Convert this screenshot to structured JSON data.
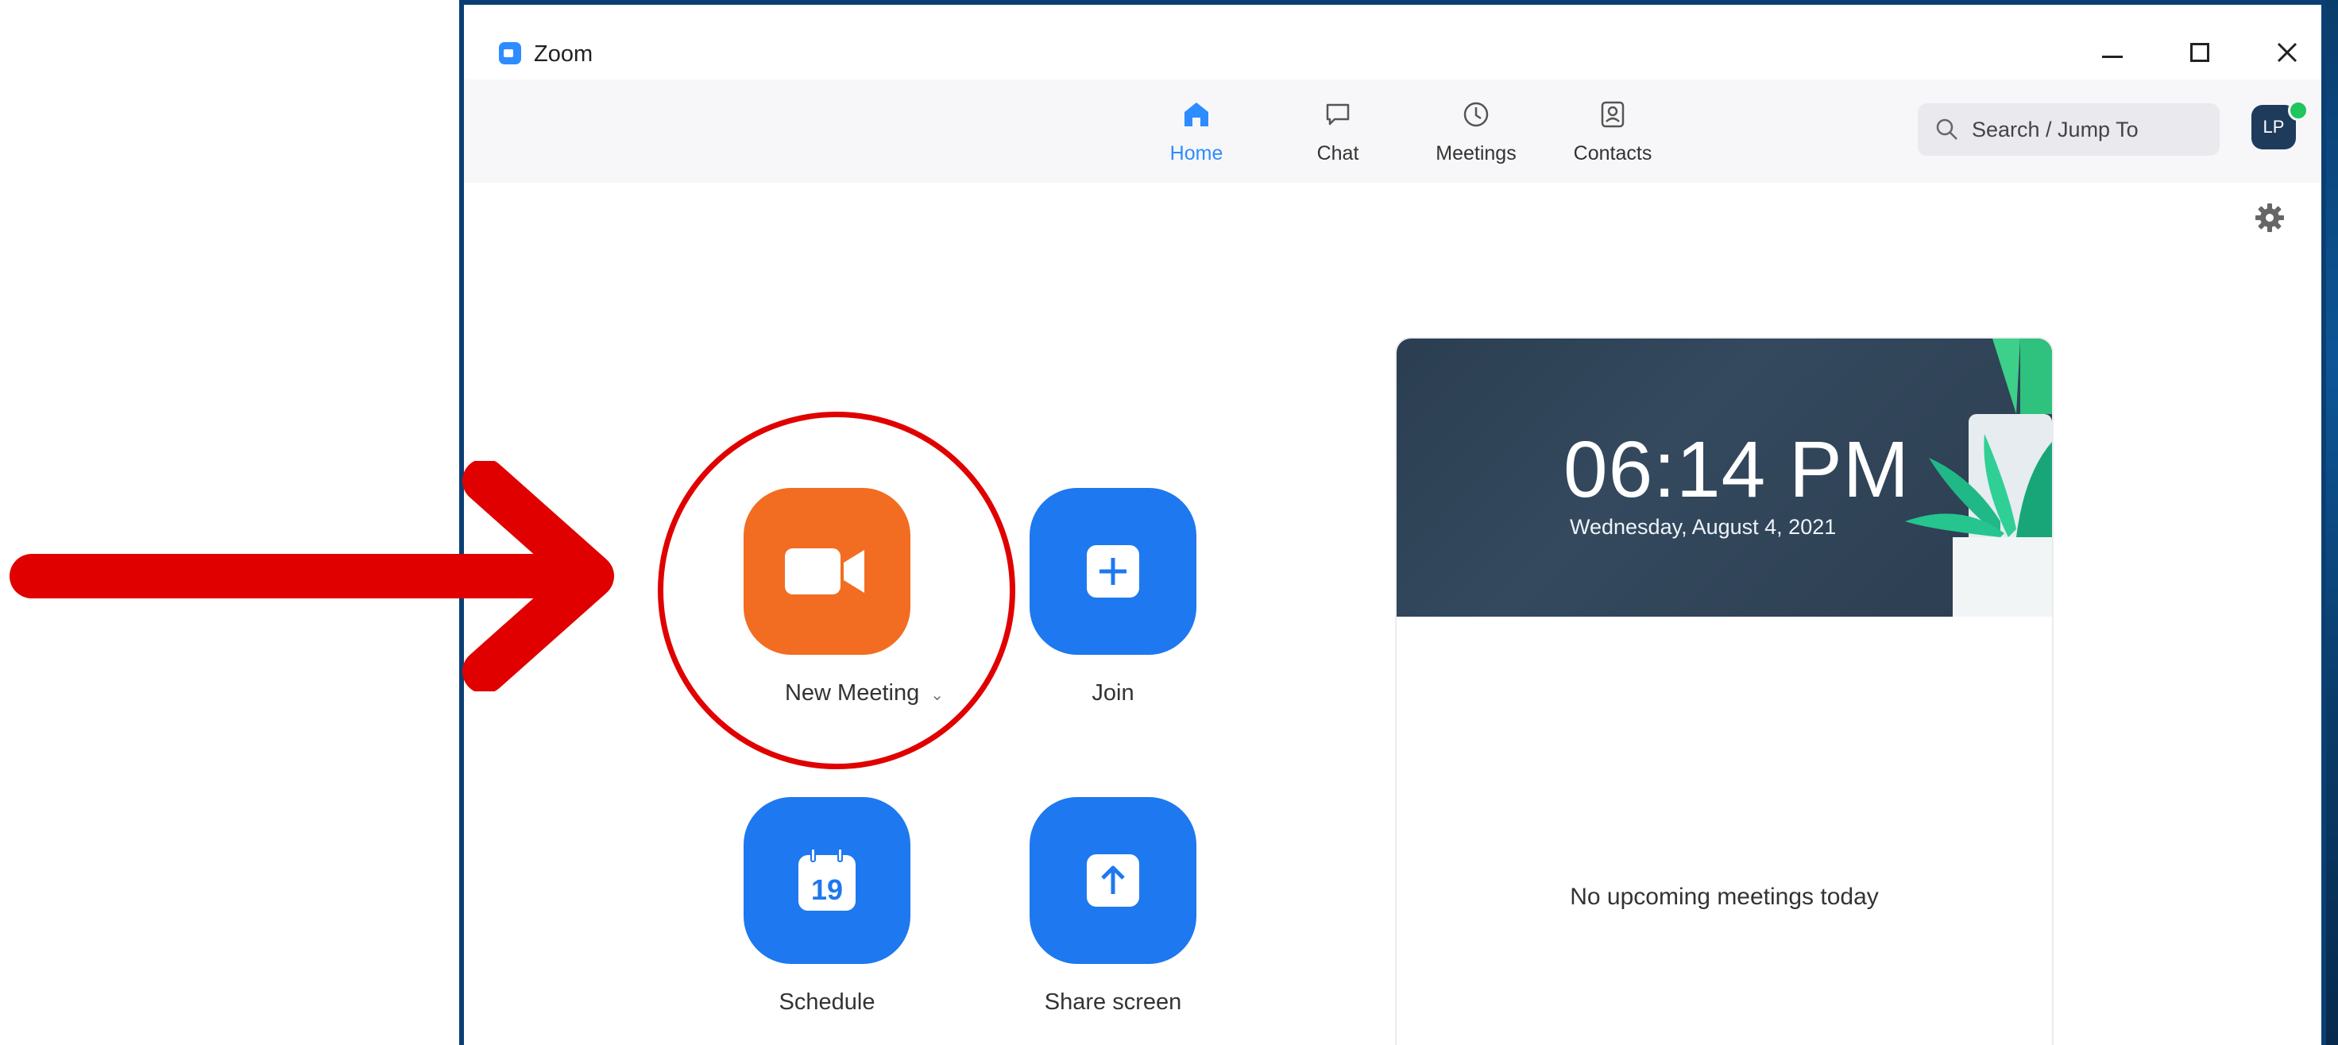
{
  "window": {
    "title": "Zoom",
    "controls": {
      "minimize": "–",
      "maximize": "□",
      "close": "✕"
    }
  },
  "tabs": [
    {
      "label": "Home",
      "icon": "home-icon",
      "active": true
    },
    {
      "label": "Chat",
      "icon": "chat-icon",
      "active": false
    },
    {
      "label": "Meetings",
      "icon": "clock-icon",
      "active": false
    },
    {
      "label": "Contacts",
      "icon": "contacts-icon",
      "active": false
    }
  ],
  "search": {
    "placeholder": "Search / Jump To"
  },
  "user": {
    "initials": "LP",
    "status_color": "#21c55d"
  },
  "actions": {
    "new_meeting": {
      "label": "New Meeting",
      "icon": "video-camera-icon",
      "color": "#f26d21"
    },
    "join": {
      "label": "Join",
      "icon": "plus-icon",
      "color": "#1e78ef"
    },
    "schedule": {
      "label": "Schedule",
      "icon": "calendar-icon",
      "calendar_day": "19",
      "color": "#1e78ef"
    },
    "share_screen": {
      "label": "Share screen",
      "icon": "upload-arrow-icon",
      "color": "#1e78ef"
    }
  },
  "clock": {
    "time": "06:14 PM",
    "date": "Wednesday, August 4, 2021"
  },
  "meetings": {
    "empty_text": "No upcoming meetings today"
  },
  "colors": {
    "accent": "#2d8cff",
    "annotation": "#e00000"
  }
}
